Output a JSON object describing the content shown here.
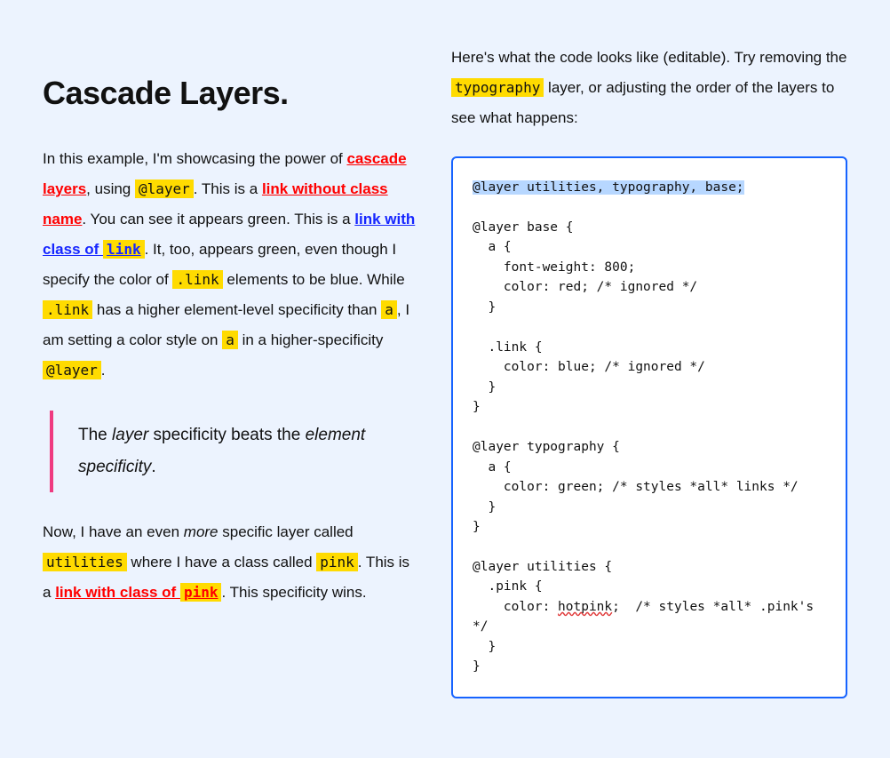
{
  "article": {
    "title": "Cascade Layers.",
    "p1": {
      "t1": "In this example, I'm showcasing the power of ",
      "link_cascade_layers": "cascade layers",
      "t2": ", using ",
      "code_layer1": "@layer",
      "t3": ". This is a ",
      "link_no_class": "link without class name",
      "t4": ". You can see it appears green. This is a ",
      "link_with_class_text": "link with class of ",
      "code_link_class": "link",
      "t5": ". It, too, appears green, even though I specify the color of ",
      "code_dot_link1": ".link",
      "t6": " elements to be blue. While ",
      "code_dot_link2": ".link",
      "t7": " has a higher element-level specificity than ",
      "code_a1": "a",
      "t8": ", I am setting a color style on ",
      "code_a2": "a",
      "t9": " in a higher-specificity ",
      "code_layer2": "@layer",
      "t10": "."
    },
    "blockquote": {
      "t1": "The ",
      "em1": "layer",
      "t2": " specificity beats the ",
      "em2": "element specificity",
      "t3": "."
    },
    "p2": {
      "t1": "Now, I have an even ",
      "em_more": "more",
      "t2": " specific layer called ",
      "code_utilities": "utilities",
      "t3": " where I have a class called ",
      "code_pink1": "pink",
      "t4": ". This is a ",
      "link_pink_text": "link with class of ",
      "code_pink_in_link": "pink",
      "t5": ". This specificity wins."
    }
  },
  "right": {
    "intro": {
      "t1": "Here's what the code looks like (editable). Try removing the ",
      "code_typography": "typography",
      "t2": " layer, or adjusting the order of the layers to see what happens:"
    },
    "code": {
      "line_decl": "@layer utilities, typography, base;",
      "block_base_open": "@layer base {",
      "base_a_open": "  a {",
      "base_a_fw": "    font-weight: 800;",
      "base_a_color": "    color: red; /* ignored */",
      "base_a_close": "  }",
      "blank": "",
      "base_link_open": "  .link {",
      "base_link_color": "    color: blue; /* ignored */",
      "base_link_close": "  }",
      "block_close": "}",
      "typo_open": "@layer typography {",
      "typo_a_open": "  a {",
      "typo_a_color": "    color: green; /* styles *all* links */",
      "typo_a_close": "  }",
      "util_open": "@layer utilities {",
      "util_pink_open": "  .pink {",
      "util_pink_color_pre": "    color: ",
      "util_pink_color_val": "hotpink",
      "util_pink_color_post": ";  /* styles *all* .pink's */",
      "util_pink_close": "  }"
    }
  }
}
